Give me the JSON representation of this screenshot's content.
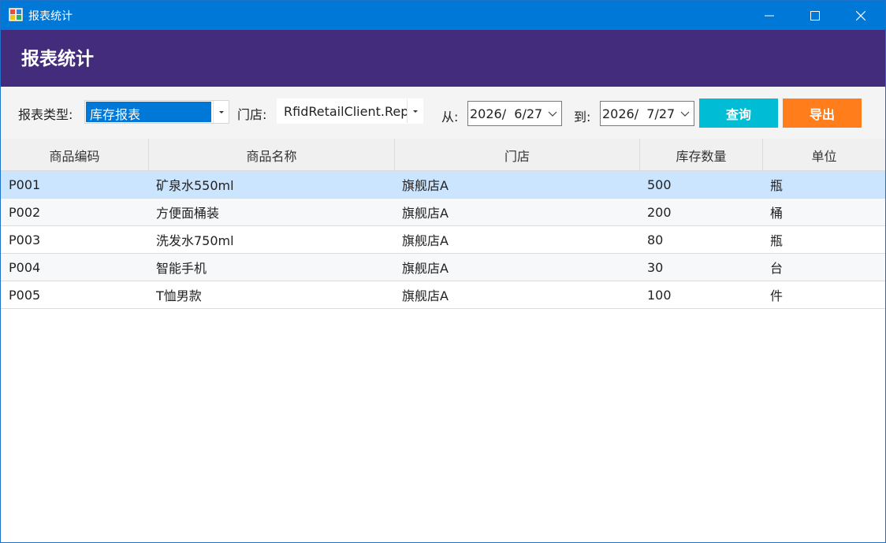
{
  "window": {
    "title": "报表统计",
    "accent": "#0078d7"
  },
  "header": {
    "title": "报表统计",
    "bg": "#432c7b"
  },
  "toolbar": {
    "report_type_label": "报表类型:",
    "report_type_value": "库存报表",
    "store_label": "门店:",
    "store_value": "RfidRetailClient.Rep",
    "from_label": "从:",
    "from_date": "2026/  6/27",
    "to_label": "到:",
    "to_date": "2026/  7/27",
    "query_label": "查询",
    "export_label": "导出"
  },
  "grid": {
    "columns": [
      "商品编码",
      "商品名称",
      "门店",
      "库存数量",
      "单位"
    ],
    "rows": [
      {
        "code": "P001",
        "name": "矿泉水550ml",
        "store": "旗舰店A",
        "qty": "500",
        "unit": "瓶"
      },
      {
        "code": "P002",
        "name": "方便面桶装",
        "store": "旗舰店A",
        "qty": "200",
        "unit": "桶"
      },
      {
        "code": "P003",
        "name": "洗发水750ml",
        "store": "旗舰店A",
        "qty": "80",
        "unit": "瓶"
      },
      {
        "code": "P004",
        "name": "智能手机",
        "store": "旗舰店A",
        "qty": "30",
        "unit": "台"
      },
      {
        "code": "P005",
        "name": "T恤男款",
        "store": "旗舰店A",
        "qty": "100",
        "unit": "件"
      }
    ]
  }
}
